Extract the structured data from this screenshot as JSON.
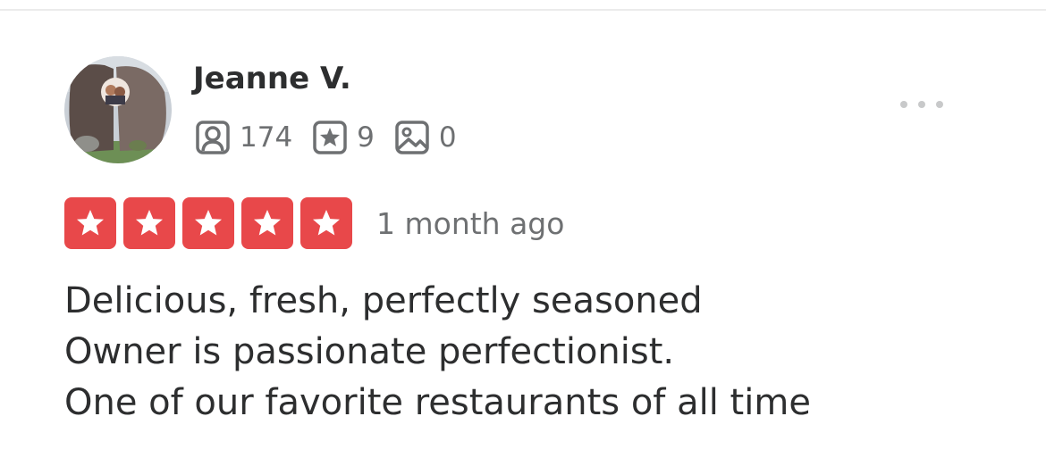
{
  "review": {
    "user": {
      "name": "Jeanne V.",
      "avatar_icon": "user-photo",
      "stats": [
        {
          "icon": "friends-icon",
          "value": "174"
        },
        {
          "icon": "reviews-icon",
          "value": "9"
        },
        {
          "icon": "photos-icon",
          "value": "0"
        }
      ]
    },
    "menu_icon": "more-options-icon",
    "rating": 5,
    "rating_color": "#e8484a",
    "date": "1 month ago",
    "text_lines": [
      "Delicious, fresh, perfectly seasoned",
      "Owner is passionate perfectionist.",
      "One of our favorite restaurants of all time"
    ]
  }
}
